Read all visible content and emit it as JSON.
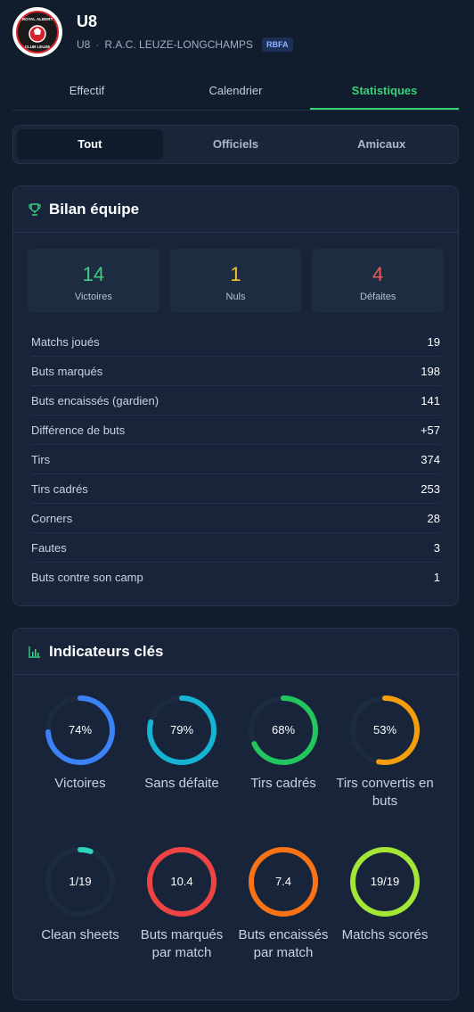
{
  "header": {
    "title": "U8",
    "subtitle_team": "U8",
    "subtitle_sep": "·",
    "subtitle_club": "R.A.C. LEUZE-LONGCHAMPS",
    "badge": "RBFA",
    "logo": "club-crest",
    "logo_text_top": "ROYAL ALBERT",
    "logo_text_bottom": "CLUB LEUZE"
  },
  "tabs": [
    {
      "label": "Effectif",
      "active": false
    },
    {
      "label": "Calendrier",
      "active": false
    },
    {
      "label": "Statistiques",
      "active": true
    }
  ],
  "filters": [
    {
      "label": "Tout",
      "active": true
    },
    {
      "label": "Officiels",
      "active": false
    },
    {
      "label": "Amicaux",
      "active": false
    }
  ],
  "bilan": {
    "title": "Bilan équipe",
    "icon": "trophy-icon",
    "summary": [
      {
        "value": "14",
        "label": "Victoires",
        "color": "#3ccf7e"
      },
      {
        "value": "1",
        "label": "Nuls",
        "color": "#f2c230"
      },
      {
        "value": "4",
        "label": "Défaites",
        "color": "#ee5a5a"
      }
    ],
    "rows": [
      {
        "label": "Matchs joués",
        "value": "19"
      },
      {
        "label": "Buts marqués",
        "value": "198"
      },
      {
        "label": "Buts encaissés (gardien)",
        "value": "141"
      },
      {
        "label": "Différence de buts",
        "value": "+57"
      },
      {
        "label": "Tirs",
        "value": "374"
      },
      {
        "label": "Tirs cadrés",
        "value": "253"
      },
      {
        "label": "Corners",
        "value": "28"
      },
      {
        "label": "Fautes",
        "value": "3"
      },
      {
        "label": "Buts contre son camp",
        "value": "1"
      }
    ]
  },
  "indicateurs": {
    "title": "Indicateurs clés",
    "icon": "bar-chart-icon",
    "gauges": [
      {
        "value": "74%",
        "label": "Victoires",
        "fraction": 0.74,
        "color": "#3b82f6"
      },
      {
        "value": "79%",
        "label": "Sans défaite",
        "fraction": 0.79,
        "color": "#17b3d3"
      },
      {
        "value": "68%",
        "label": "Tirs cadrés",
        "fraction": 0.68,
        "color": "#22c55e"
      },
      {
        "value": "53%",
        "label": "Tirs convertis en buts",
        "fraction": 0.53,
        "color": "#f59e0b"
      },
      {
        "value": "1/19",
        "label": "Clean sheets",
        "fraction": 0.0526,
        "color": "#2dd4bf"
      },
      {
        "value": "10.4",
        "label": "Buts marqués par match",
        "fraction": 1.0,
        "color": "#ef4444"
      },
      {
        "value": "7.4",
        "label": "Buts encaissés par match",
        "fraction": 1.0,
        "color": "#f97316"
      },
      {
        "value": "19/19",
        "label": "Matchs scorés",
        "fraction": 1.0,
        "color": "#a3e635"
      }
    ]
  }
}
